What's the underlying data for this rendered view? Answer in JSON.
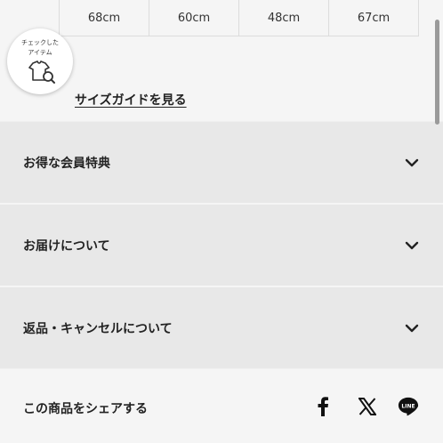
{
  "size_table": {
    "cells": [
      "68cm",
      "60cm",
      "48cm",
      "67cm"
    ]
  },
  "checked_items_badge": {
    "line1": "チェックした",
    "line2": "アイテム"
  },
  "size_guide_link": "サイズガイドを見る",
  "accordion": [
    {
      "label": "お得な会員特典"
    },
    {
      "label": "お届けについて"
    },
    {
      "label": "返品・キャンセルについて"
    }
  ],
  "share": {
    "label": "この商品をシェアする",
    "icons": [
      "facebook-icon",
      "x-icon",
      "line-icon"
    ],
    "line_text": "LINE"
  },
  "colors": {
    "accordion_bg": "#e8e8e8",
    "page_bg": "#f5f5f5",
    "text": "#222222"
  }
}
